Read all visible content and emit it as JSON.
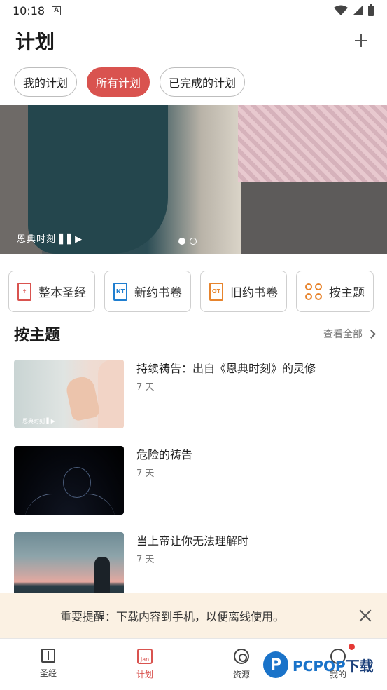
{
  "status_bar": {
    "time": "10:18",
    "a_badge": "A"
  },
  "header": {
    "title": "计划",
    "add_icon": "plus-icon"
  },
  "tabs": [
    {
      "label": "我的计划",
      "active": false
    },
    {
      "label": "所有计划",
      "active": true
    },
    {
      "label": "已完成的计划",
      "active": false
    }
  ],
  "banner": {
    "logo_text": "恩典时刻 ▌▌▶",
    "slide_count": 2,
    "active_slide": 1
  },
  "categories": [
    {
      "label": "整本圣经",
      "icon": "bible-book-icon",
      "color": "#d9534f",
      "icon_text": "✝"
    },
    {
      "label": "新约书卷",
      "icon": "nt-book-icon",
      "color": "#1f7ed0",
      "icon_text": "NT"
    },
    {
      "label": "旧约书卷",
      "icon": "ot-book-icon",
      "color": "#e7842d",
      "icon_text": "OT"
    },
    {
      "label": "按主题",
      "icon": "topics-grid-icon",
      "color": "#e7842d"
    }
  ],
  "section": {
    "title": "按主题",
    "see_all": "查看全部"
  },
  "plans": [
    {
      "title": "持续祷告：出自《恩典时刻》的灵修",
      "days": "7 天",
      "thumb_mark": "恩典时刻 ▌▶"
    },
    {
      "title": "危险的祷告",
      "days": "7 天"
    },
    {
      "title": "当上帝让你无法理解时",
      "days": "7 天"
    }
  ],
  "notice": {
    "text": "重要提醒：下载内容到手机，以便离线使用。"
  },
  "bottom_nav": [
    {
      "label": "圣经",
      "icon": "bible-icon",
      "active": false
    },
    {
      "label": "计划",
      "icon": "calendar-icon",
      "active": true,
      "icon_text": "Jan"
    },
    {
      "label": "资源",
      "icon": "disc-icon",
      "active": false
    },
    {
      "label": "我的",
      "icon": "person-icon",
      "active": false,
      "has_badge": true
    }
  ],
  "watermark": {
    "logo": "P",
    "text_pc": "PCPOP",
    "text_rest": "下载"
  },
  "colors": {
    "accent": "#d9534f",
    "nt_blue": "#1f7ed0",
    "ot_orange": "#e7842d",
    "notice_bg": "#fbf1e3"
  }
}
